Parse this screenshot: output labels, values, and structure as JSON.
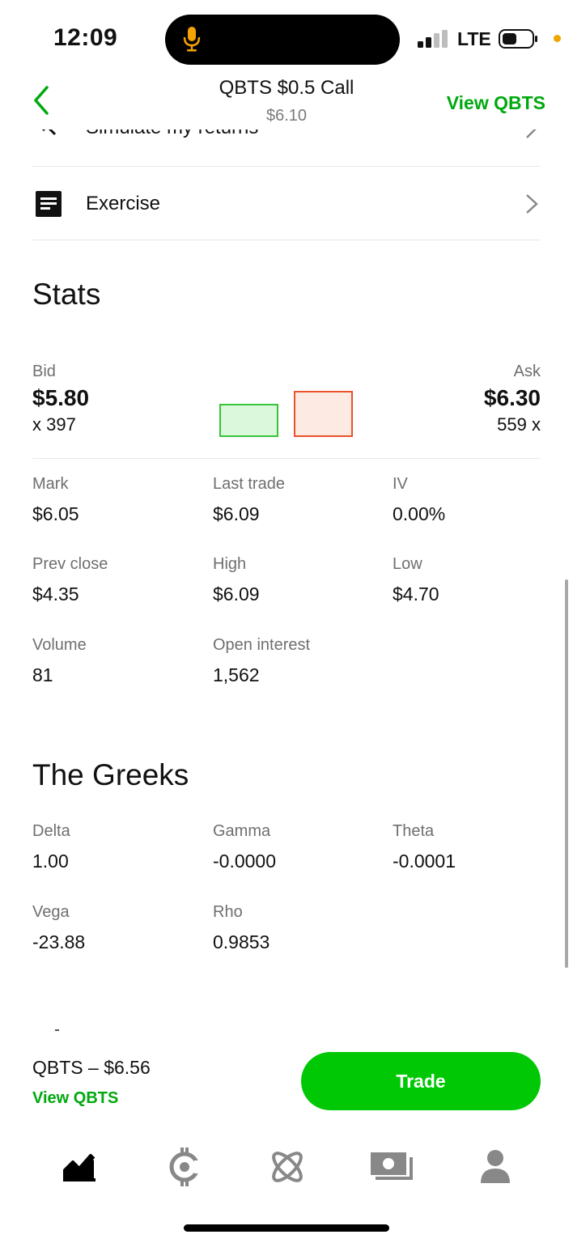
{
  "status_bar": {
    "time": "12:09",
    "network": "LTE"
  },
  "header": {
    "title": "QBTS $0.5 Call",
    "subtitle": "$6.10",
    "view_link": "View QBTS"
  },
  "list": {
    "clipped_item_label": "Simulate my returns",
    "exercise_label": "Exercise"
  },
  "stats": {
    "title": "Stats",
    "bid": {
      "label": "Bid",
      "price": "$5.80",
      "size": "x 397"
    },
    "ask": {
      "label": "Ask",
      "price": "$6.30",
      "size": "559 x"
    },
    "rows": [
      [
        {
          "label": "Mark",
          "value": "$6.05"
        },
        {
          "label": "Last trade",
          "value": "$6.09"
        },
        {
          "label": "IV",
          "value": "0.00%"
        }
      ],
      [
        {
          "label": "Prev close",
          "value": "$4.35"
        },
        {
          "label": "High",
          "value": "$6.09"
        },
        {
          "label": "Low",
          "value": "$4.70"
        }
      ],
      [
        {
          "label": "Volume",
          "value": "81"
        },
        {
          "label": "Open interest",
          "value": "1,562"
        }
      ]
    ]
  },
  "greeks": {
    "title": "The Greeks",
    "rows": [
      [
        {
          "label": "Delta",
          "value": "1.00"
        },
        {
          "label": "Gamma",
          "value": "-0.0000"
        },
        {
          "label": "Theta",
          "value": "-0.0001"
        }
      ],
      [
        {
          "label": "Vega",
          "value": "-23.88"
        },
        {
          "label": "Rho",
          "value": "0.9853"
        }
      ]
    ]
  },
  "trade_bar": {
    "ticker_price": "QBTS – $6.56",
    "view_link": "View QBTS",
    "trade_label": "Trade"
  },
  "tabs": [
    "investing-icon",
    "crypto-icon",
    "network-icon",
    "cash-icon",
    "account-icon"
  ],
  "colors": {
    "brand_green": "#00c805",
    "link_green": "#00a90f",
    "bid_green": "#35c43a",
    "ask_orange": "#e8532a"
  }
}
